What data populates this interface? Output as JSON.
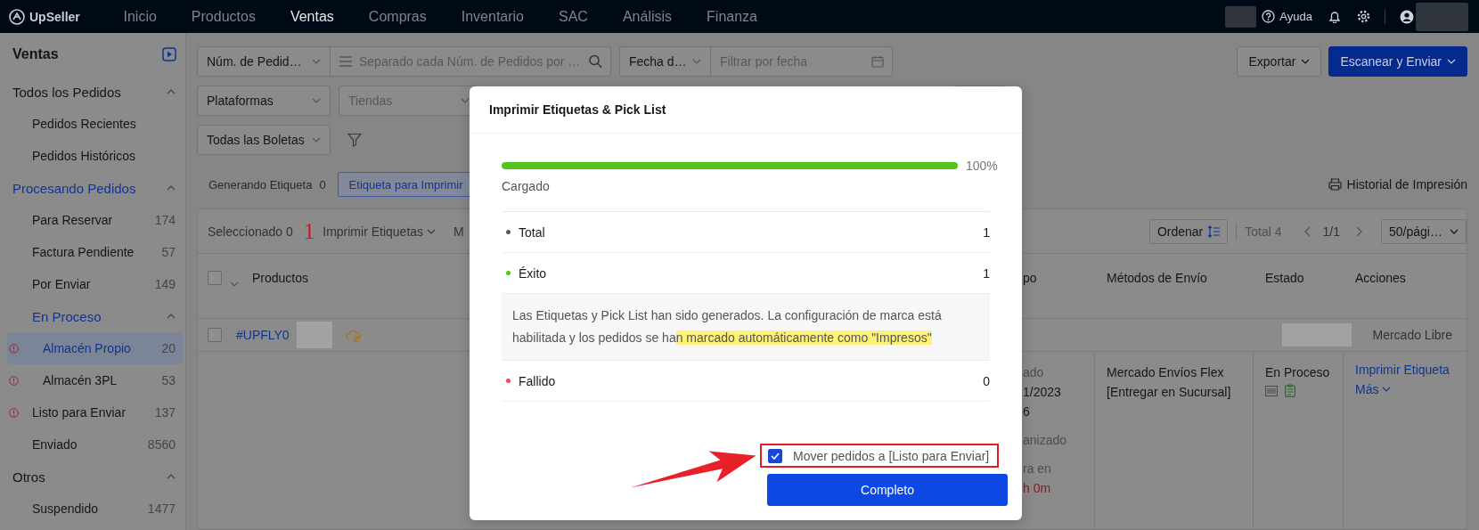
{
  "top_bar": {
    "logo": "UpSeller",
    "nav": [
      {
        "label": "Inicio",
        "selected": false
      },
      {
        "label": "Productos",
        "selected": false
      },
      {
        "label": "Ventas",
        "selected": true
      },
      {
        "label": "Compras",
        "selected": false
      },
      {
        "label": "Inventario",
        "selected": false
      },
      {
        "label": "SAC",
        "selected": false
      },
      {
        "label": "Análisis",
        "selected": false
      },
      {
        "label": "Finanza",
        "selected": false
      }
    ],
    "help": "Ayuda"
  },
  "sidebar": {
    "title": "Ventas",
    "items": [
      {
        "kind": "group",
        "label": "Todos los Pedidos",
        "expanded": true,
        "active": false,
        "children": [
          {
            "kind": "item",
            "label": "Pedidos Recientes",
            "selected": false,
            "alert": false
          },
          {
            "kind": "item",
            "label": "Pedidos Históricos",
            "selected": false,
            "alert": false
          }
        ]
      },
      {
        "kind": "group",
        "label": "Procesando Pedidos",
        "expanded": true,
        "active": true,
        "children": [
          {
            "kind": "item",
            "label": "Para Reservar",
            "count": "174",
            "selected": false,
            "alert": false
          },
          {
            "kind": "item",
            "label": "Factura Pendiente",
            "count": "57",
            "selected": false,
            "alert": false
          },
          {
            "kind": "item",
            "label": "Por Enviar",
            "count": "149",
            "selected": false,
            "alert": false
          },
          {
            "kind": "group",
            "label": "En Proceso",
            "expanded": true,
            "active": true,
            "children": [
              {
                "kind": "item",
                "label": "Almacén Propio",
                "count": "20",
                "selected": true,
                "alert": true
              },
              {
                "kind": "item",
                "label": "Almacén 3PL",
                "count": "53",
                "selected": false,
                "alert": true
              }
            ]
          },
          {
            "kind": "item",
            "label": "Listo para Enviar",
            "count": "137",
            "selected": false,
            "alert": true
          },
          {
            "kind": "item",
            "label": "Enviado",
            "count": "8560",
            "selected": false,
            "alert": false
          }
        ]
      },
      {
        "kind": "group",
        "label": "Otros",
        "expanded": true,
        "active": false,
        "children": [
          {
            "kind": "item",
            "label": "Suspendido",
            "count": "1477",
            "selected": false,
            "alert": false
          }
        ]
      }
    ]
  },
  "filters": {
    "order_number_select": "Núm. de Pedid…",
    "search": {
      "placeholder": "Separado cada Núm. de Pedidos por …"
    },
    "date_select": "Fecha d…",
    "date_field": {
      "placeholder": "Filtrar por fecha"
    },
    "platforms": "Plataformas",
    "stores": {
      "placeholder": "Tiendas"
    },
    "receipts": "Todas las Boletas"
  },
  "actions": [
    {
      "label": "Exportar",
      "kind": "default"
    },
    {
      "label": "Escanear y Enviar",
      "kind": "primary"
    }
  ],
  "status_tabs": [
    {
      "label": "Generando Etiqueta",
      "count": "0",
      "selected": false
    },
    {
      "label": "Etiqueta para Imprimir",
      "selected": true
    }
  ],
  "print_history": "Historial de Impresión",
  "table": {
    "toolbar": {
      "selected": "Seleccionado 0",
      "annotation": "1",
      "bulk_action": "Imprimir Etiquetas",
      "next_action": "M",
      "sort": "Ordenar",
      "total": "Total 4",
      "page": "1/1",
      "page_size": "50/pági…"
    },
    "select_all_checked": false,
    "columns": [
      "Productos",
      "po",
      "Métodos de Envío",
      "Estado",
      "Acciones"
    ],
    "orders": [
      {
        "number": "#UPFLY0",
        "platform": "Mercado Libre",
        "column_2": [
          [
            {
              "text": "ado",
              "muted": true,
              "alert": false
            },
            {
              "text": "1/2023",
              "muted": false,
              "alert": false
            },
            {
              "text": "6",
              "muted": false,
              "alert": false
            }
          ],
          [
            {
              "text": "anizado",
              "muted": true,
              "alert": false
            }
          ],
          [
            {
              "text": "ra en",
              "muted": true,
              "alert": false
            },
            {
              "text": "h 0m",
              "muted": false,
              "alert": true
            }
          ]
        ],
        "checked": false,
        "shipping": "Mercado Envíos Flex [Entregar en Sucursal]",
        "status": "En Proceso",
        "actions": [
          "Imprimir Etiqueta",
          "Más"
        ]
      }
    ]
  },
  "modal": {
    "title": "Imprimir Etiquetas & Pick List",
    "progress": {
      "level": 1,
      "percent": "100%",
      "label": "Cargado"
    },
    "summary": [
      {
        "kind": "count",
        "label": "Total",
        "value": "1",
        "color": "#595959"
      },
      {
        "kind": "count",
        "label": "Éxito",
        "value": "1",
        "color": "#52c41a"
      },
      {
        "kind": "notice",
        "text": "Las Etiquetas y Pick List han sido generados. La configuración de marca está habilitada y los pedidos se ha",
        "highlight": "n marcado automáticamente como \"Impresos\""
      },
      {
        "kind": "count",
        "label": "Fallido",
        "value": "0",
        "color": "#f5455c"
      }
    ],
    "move_orders": {
      "label": "Mover pedidos a [Listo para Enviar]",
      "checked": true
    },
    "confirm": "Completo"
  }
}
